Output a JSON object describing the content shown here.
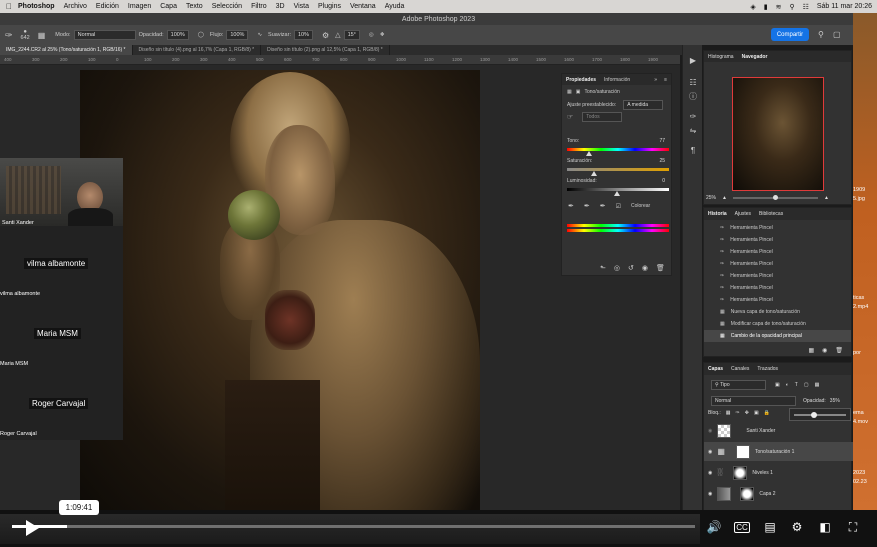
{
  "menubar": {
    "app": "Photoshop",
    "items": [
      "Archivo",
      "Edición",
      "Imagen",
      "Capa",
      "Texto",
      "Selección",
      "Filtro",
      "3D",
      "Vista",
      "Plugins",
      "Ventana",
      "Ayuda"
    ],
    "clock": "Sáb 11 mar 20:26"
  },
  "window_title": "Adobe Photoshop 2023",
  "options": {
    "brush_size": "642",
    "mode_label": "Modo:",
    "mode_value": "Normal",
    "opacity_label": "Opacidad:",
    "opacity_value": "100%",
    "flow_label": "Flujo:",
    "flow_value": "100%",
    "smoothing_label": "Suavizar:",
    "smoothing_value": "10%",
    "angle_value": "15°",
    "share_label": "Compartir"
  },
  "tabs": [
    {
      "label": "IMG_2244.CR2 al 25% (Tono/saturación 1, RGB/16) *",
      "active": true
    },
    {
      "label": "Diseño sin título (4).png al 16,7% (Capa 1, RGB/8) *",
      "active": false
    },
    {
      "label": "Diseño sin título (2).png al 12,5% (Capa 1, RGB/8) *",
      "active": false
    }
  ],
  "ruler_marks": [
    "400",
    "300",
    "200",
    "100",
    "0",
    "100",
    "200",
    "300",
    "400",
    "500",
    "600",
    "700",
    "800",
    "900",
    "1000",
    "1100",
    "1200",
    "1300",
    "1400",
    "1500",
    "1600",
    "1700",
    "1800",
    "1900",
    "2000",
    "2100",
    "2200",
    "2300",
    "2400",
    "2500",
    "2600",
    "2700",
    "2800",
    "2900",
    "3000",
    "3100",
    "3200",
    "3300",
    "3400",
    "3500",
    "3600",
    "3700",
    "3800",
    "3900",
    "4000",
    "4100",
    "4200"
  ],
  "call": {
    "cam_name": "Santi Xander",
    "participants": [
      {
        "big": "vilma albamonte",
        "small": "vilma albamonte"
      },
      {
        "big": "Maria MSM",
        "small": "Maria MSM"
      },
      {
        "big": "Roger Carvajal",
        "small": "Roger Carvajal"
      }
    ]
  },
  "properties": {
    "tab_props": "Propiedades",
    "tab_info": "Información",
    "layer_type": "Tono/saturación",
    "preset_label": "Ajuste preestablecido:",
    "preset_value": "A medida",
    "channel_value": "Todos",
    "hue_label": "Tono:",
    "hue_value": "77",
    "sat_label": "Saturación:",
    "sat_value": "25",
    "light_label": "Luminosidad:",
    "light_value": "0",
    "colorize_label": "Colorear"
  },
  "navigator": {
    "tab_hist": "Histograma",
    "tab_nav": "Navegador",
    "zoom": "25%"
  },
  "history": {
    "tab_hist": "Historia",
    "tab_adj": "Ajustes",
    "tab_lib": "Bibliotecas",
    "items": [
      "Herramienta Pincel",
      "Herramienta Pincel",
      "Herramienta Pincel",
      "Herramienta Pincel",
      "Herramienta Pincel",
      "Herramienta Pincel",
      "Herramienta Pincel",
      "Nueva capa de tono/saturación",
      "Modificar capa de tono/saturación",
      "Cambio de la opacidad principal"
    ]
  },
  "layers": {
    "tab_layers": "Capas",
    "tab_channels": "Canales",
    "tab_paths": "Trazados",
    "kind_label": "Tipo",
    "blend_value": "Normal",
    "opacity_label": "Opacidad:",
    "opacity_value": "35%",
    "lock_label": "Bloq.:",
    "items": [
      "Santi Xander",
      "Tono/saturación 1",
      "Niveles 1",
      "Capa 2"
    ]
  },
  "desktop_labels": [
    "1909",
    "5.jpg",
    "ticas",
    "2.mp4",
    "por",
    "ema",
    "4.mov",
    "2023",
    "02.23"
  ],
  "player": {
    "timestamp": "1:09:41",
    "progress": 0.08,
    "accent": "#ffffff"
  }
}
